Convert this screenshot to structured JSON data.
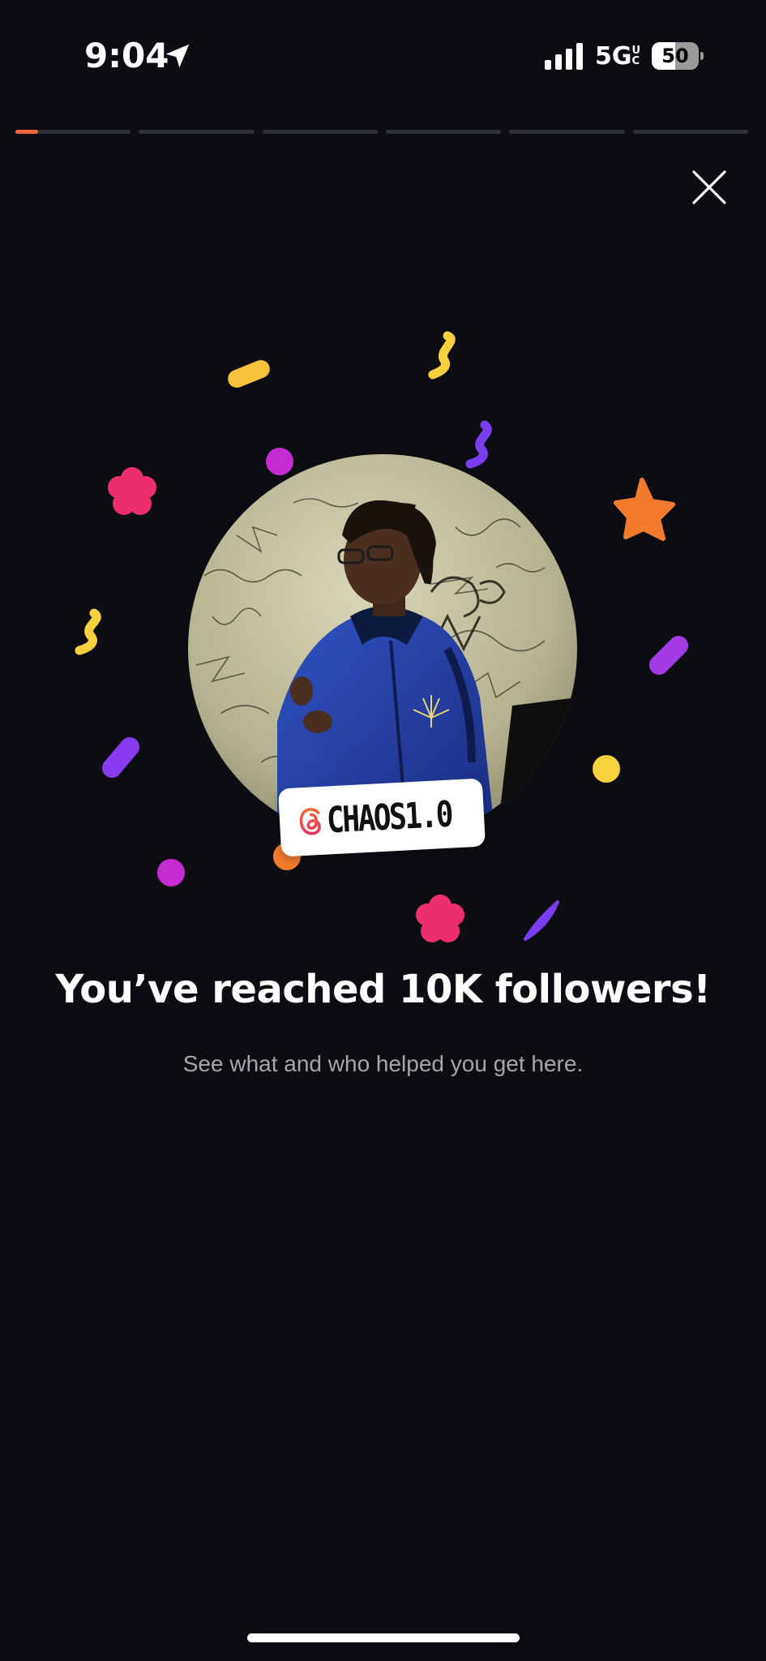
{
  "status_bar": {
    "time": "9:04",
    "network": "5G",
    "network_superscript": "UC",
    "battery_level": "50",
    "battery_fraction": 0.5
  },
  "story_progress": {
    "segment_count": 6,
    "active_index": 0,
    "active_fraction": 0.2,
    "accent_color": "#f4693a"
  },
  "close": {
    "icon": "close-icon"
  },
  "profile": {
    "username": "CHAOS1.0",
    "badge_icon": "threads-logo-icon"
  },
  "milestone": {
    "headline": "You’ve reached 10K followers!",
    "subtitle": "See what and who helped you get here."
  },
  "colors": {
    "background": "#0b0d13",
    "confetti_yellow": "#f7d13b",
    "confetti_pink": "#ed2d6c",
    "confetti_purple": "#8a3bf0",
    "confetti_magenta": "#c42bd0",
    "confetti_orange": "#f47a2e"
  }
}
